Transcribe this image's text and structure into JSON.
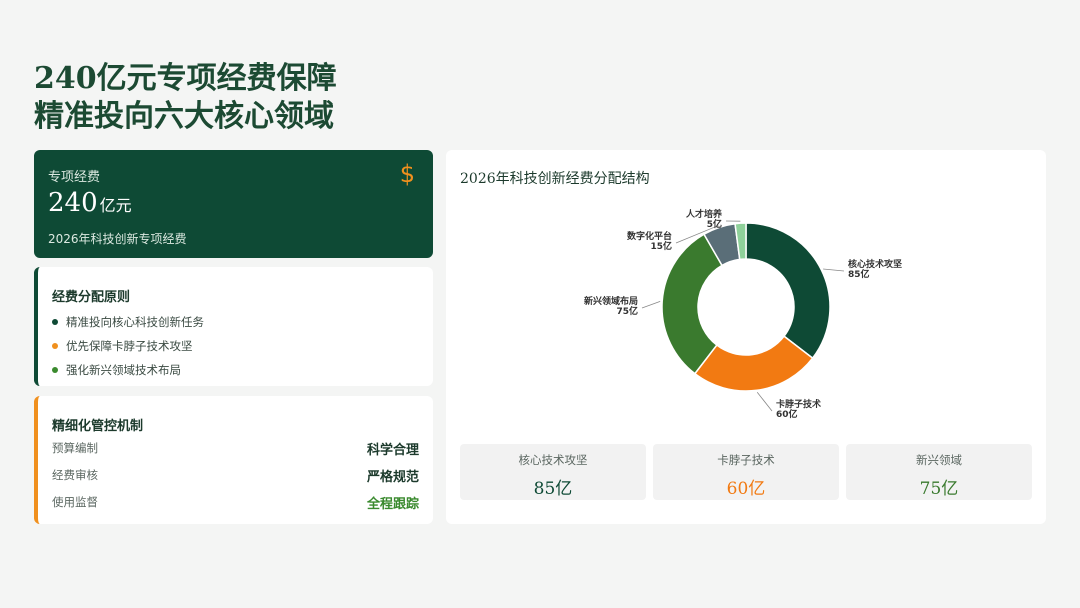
{
  "title": {
    "line1": "240亿元专项经费保障",
    "line2": "精准投向六大核心领域"
  },
  "budget": {
    "label": "专项经费",
    "amount": "240",
    "unit": "亿元",
    "subtitle": "2026年科技创新专项经费",
    "icon": "dollar-icon"
  },
  "principles": {
    "heading": "经费分配原则",
    "items": [
      {
        "text": "精准投向核心科技创新任务",
        "color": "#0e4a35"
      },
      {
        "text": "优先保障卡脖子技术攻坚",
        "color": "#f0901e"
      },
      {
        "text": "强化新兴领域技术布局",
        "color": "#3a8a2e"
      }
    ]
  },
  "control": {
    "heading": "精细化管控机制",
    "rows": [
      {
        "key": "预算编制",
        "value": "科学合理"
      },
      {
        "key": "经费审核",
        "value": "严格规范"
      },
      {
        "key": "使用监督",
        "value": "全程跟踪"
      }
    ]
  },
  "chart_data": {
    "type": "pie",
    "title": "2026年科技创新经费分配结构",
    "unit": "亿",
    "series": [
      {
        "name": "核心技术攻坚",
        "value": 85,
        "label": "85亿",
        "color": "#0e4a35"
      },
      {
        "name": "卡脖子技术",
        "value": 60,
        "label": "60亿",
        "color": "#f27a12"
      },
      {
        "name": "新兴领域布局",
        "value": 75,
        "label": "75亿",
        "color": "#3a7a2e"
      },
      {
        "name": "数字化平台",
        "value": 15,
        "label": "15亿",
        "color": "#5a6e78"
      },
      {
        "name": "人才培养",
        "value": 5,
        "label": "5亿",
        "color": "#8fd19a"
      }
    ]
  },
  "stats": [
    {
      "label": "核心技术攻坚",
      "value": "85亿",
      "color": "#0e4a35"
    },
    {
      "label": "卡脖子技术",
      "value": "60亿",
      "color": "#f27a12"
    },
    {
      "label": "新兴领域",
      "value": "75亿",
      "color": "#3a7a2e"
    }
  ]
}
